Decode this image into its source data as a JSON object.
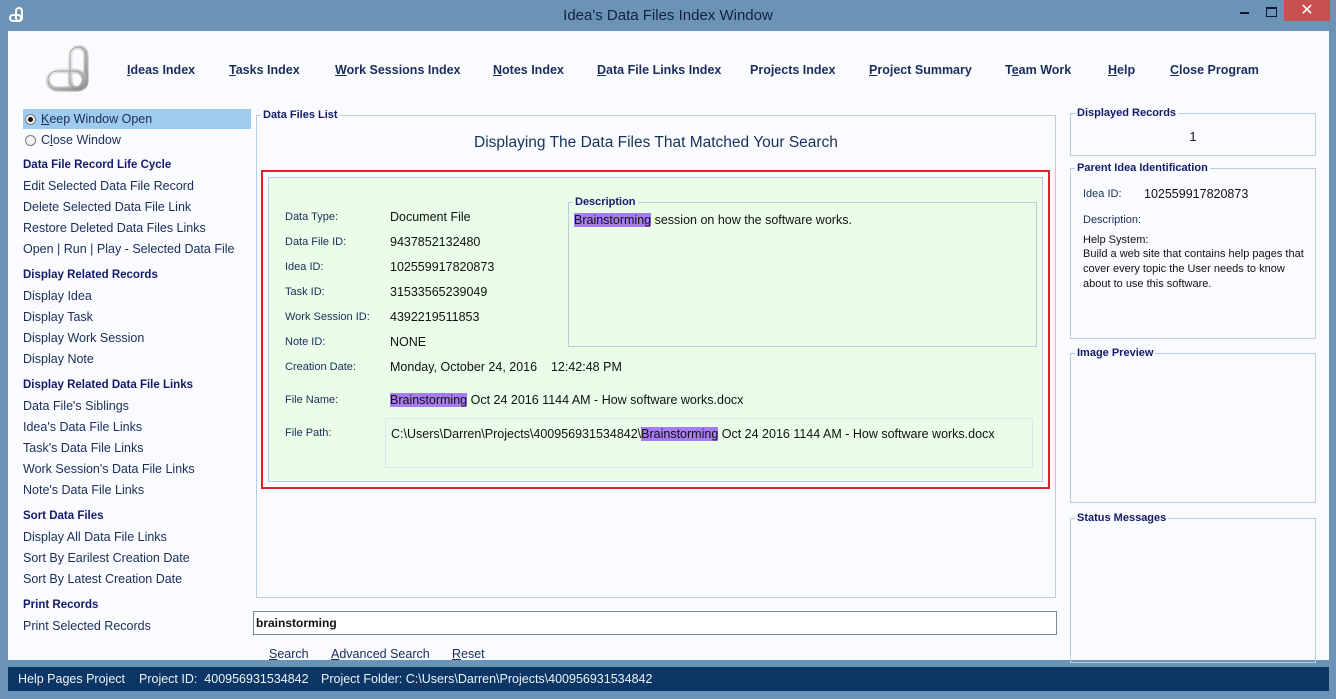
{
  "window": {
    "title": "Idea's Data Files Index Window",
    "close_glyph": "✕"
  },
  "nav": [
    {
      "label_ul": "I",
      "label_rest": "deas Index"
    },
    {
      "label_ul": "T",
      "label_rest": "asks Index"
    },
    {
      "label_ul": "W",
      "label_rest": "ork Sessions Index"
    },
    {
      "label_ul": "N",
      "label_rest": "otes Index"
    },
    {
      "label_ul": "D",
      "label_rest": "ata File Links Index"
    },
    {
      "label_ul": "",
      "label_rest": "Projects Index"
    },
    {
      "label_ul": "P",
      "label_rest": "roject Summary"
    },
    {
      "label_pre": "T",
      "label_ul": "e",
      "label_rest": "am Work"
    },
    {
      "label_ul": "H",
      "label_rest": "elp"
    },
    {
      "label_ul": "C",
      "label_rest": "lose Program"
    }
  ],
  "sidebar": {
    "keep_open": {
      "ul": "K",
      "rest": "eep Window Open",
      "selected": true
    },
    "close_window": {
      "pre": "C",
      "ul": "l",
      "rest": "ose Window",
      "selected": false
    },
    "sections": [
      {
        "heading": "Data File Record Life Cycle",
        "items": [
          "Edit Selected Data File Record",
          "Delete Selected Data File Link",
          "Restore Deleted Data Files Links",
          "Open | Run | Play - Selected Data File"
        ]
      },
      {
        "heading": "Display Related Records",
        "items": [
          "Display Idea",
          "Display Task",
          "Display Work Session",
          "Display Note"
        ]
      },
      {
        "heading": "Display Related Data File Links",
        "items": [
          "Data File's Siblings",
          "Idea's Data File Links",
          "Task's Data File Links",
          "Work Session's Data File Links",
          "Note's Data File Links"
        ]
      },
      {
        "heading": "Sort Data Files",
        "items": [
          "Display All Data File Links",
          "Sort By Earilest Creation Date",
          "Sort By Latest Creation Date"
        ]
      },
      {
        "heading": "Print Records",
        "items": [
          "Print Selected Records"
        ]
      }
    ]
  },
  "data_files_list": {
    "group_label": "Data Files List",
    "heading": "Displaying The Data Files That Matched Your Search",
    "record": {
      "fields": [
        {
          "label": "Data Type:",
          "value": "Document File"
        },
        {
          "label": "Data File ID:",
          "value": "9437852132480"
        },
        {
          "label": "Idea ID:",
          "value": "102559917820873"
        },
        {
          "label": "Task ID:",
          "value": "31533565239049"
        },
        {
          "label": "Work Session ID:",
          "value": "4392219511853"
        },
        {
          "label": "Note ID:",
          "value": "NONE"
        },
        {
          "label": "Creation Date:",
          "value": "Monday, October 24, 2016    12:42:48 PM"
        }
      ],
      "description_label": "Description",
      "description_highlight": "Brainstorming",
      "description_rest": " session on how the software works.",
      "file_name_label": "File Name:",
      "file_name_highlight": "Brainstorming",
      "file_name_rest": " Oct 24 2016 1144 AM - How software works.docx",
      "file_path_label": "File Path:",
      "file_path_pre": "C:\\Users\\Darren\\Projects\\400956931534842\\",
      "file_path_highlight": "Brainstorming",
      "file_path_rest": " Oct 24 2016 1144 AM - How software works.docx",
      "highlight_color": "#a67cf0"
    }
  },
  "search": {
    "value": "brainstorming",
    "search": {
      "ul": "S",
      "rest": "earch"
    },
    "advanced": {
      "ul": "A",
      "rest": "dvanced Search"
    },
    "reset": {
      "ul": "R",
      "rest": "eset"
    }
  },
  "right_panel": {
    "displayed_records_label": "Displayed Records",
    "displayed_records_count": "1",
    "parent_idea_label": "Parent Idea Identification",
    "idea_id_label": "Idea ID:",
    "idea_id_value": "102559917820873",
    "description_label": "Description:",
    "description_title": "Help System:",
    "description_text": "Build a web site that contains help pages that cover every topic the User needs to know about to use this software.",
    "image_preview_label": "Image Preview",
    "status_messages_label": "Status Messages"
  },
  "statusbar": {
    "project_name": "Help Pages Project",
    "project_id": "Project ID:  400956931534842",
    "project_folder": "Project Folder: C:\\Users\\Darren\\Projects\\400956931534842"
  },
  "colors": {
    "highlight_border": "#e0222a",
    "record_bg": "#e9fde8",
    "statusbar_bg": "#0b3666",
    "titlebar_bg": "#6b93b6"
  }
}
